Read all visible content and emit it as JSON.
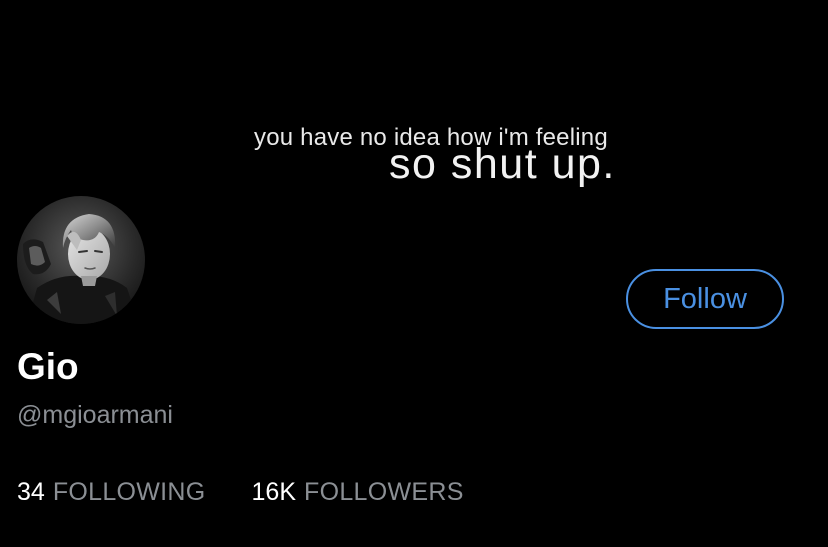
{
  "banner": {
    "line1": "you have no idea how i'm feeling",
    "line2": "so shut up."
  },
  "profile": {
    "display_name": "Gio",
    "handle": "@mgioarmani",
    "follow_label": "Follow"
  },
  "stats": {
    "following_count": "34",
    "following_label": "FOLLOWING",
    "followers_count": "16K",
    "followers_label": "FOLLOWERS"
  },
  "colors": {
    "background": "#000000",
    "accent": "#4a90e2",
    "primary_text": "#ffffff",
    "secondary_text": "#8b8f94"
  }
}
